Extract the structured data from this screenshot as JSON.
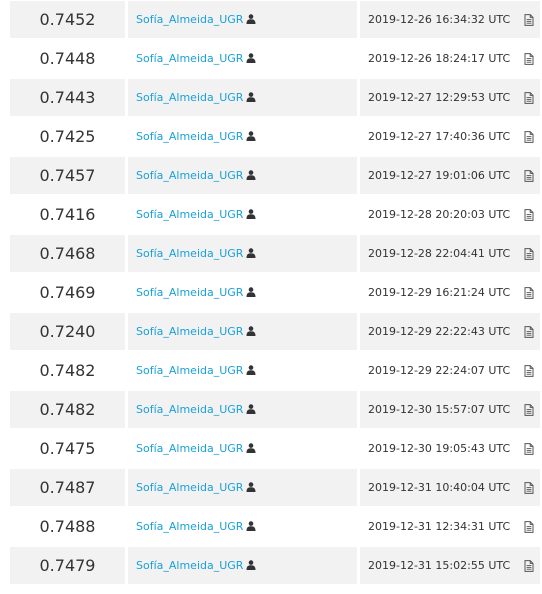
{
  "icons": {
    "user": "user-icon",
    "file": "file-icon"
  },
  "colors": {
    "link": "#1aa0d8",
    "stripe": "#f2f2f2",
    "text": "#333333"
  },
  "rows": [
    {
      "score": "0.7452",
      "user": "Sofía_Almeida_UGR",
      "date": "2019-12-26 16:34:32 UTC"
    },
    {
      "score": "0.7448",
      "user": "Sofía_Almeida_UGR",
      "date": "2019-12-26 18:24:17 UTC"
    },
    {
      "score": "0.7443",
      "user": "Sofía_Almeida_UGR",
      "date": "2019-12-27 12:29:53 UTC"
    },
    {
      "score": "0.7425",
      "user": "Sofía_Almeida_UGR",
      "date": "2019-12-27 17:40:36 UTC"
    },
    {
      "score": "0.7457",
      "user": "Sofía_Almeida_UGR",
      "date": "2019-12-27 19:01:06 UTC"
    },
    {
      "score": "0.7416",
      "user": "Sofía_Almeida_UGR",
      "date": "2019-12-28 20:20:03 UTC"
    },
    {
      "score": "0.7468",
      "user": "Sofía_Almeida_UGR",
      "date": "2019-12-28 22:04:41 UTC"
    },
    {
      "score": "0.7469",
      "user": "Sofía_Almeida_UGR",
      "date": "2019-12-29 16:21:24 UTC"
    },
    {
      "score": "0.7240",
      "user": "Sofía_Almeida_UGR",
      "date": "2019-12-29 22:22:43 UTC"
    },
    {
      "score": "0.7482",
      "user": "Sofía_Almeida_UGR",
      "date": "2019-12-29 22:24:07 UTC"
    },
    {
      "score": "0.7482",
      "user": "Sofía_Almeida_UGR",
      "date": "2019-12-30 15:57:07 UTC"
    },
    {
      "score": "0.7475",
      "user": "Sofía_Almeida_UGR",
      "date": "2019-12-30 19:05:43 UTC"
    },
    {
      "score": "0.7487",
      "user": "Sofía_Almeida_UGR",
      "date": "2019-12-31 10:40:04 UTC"
    },
    {
      "score": "0.7488",
      "user": "Sofía_Almeida_UGR",
      "date": "2019-12-31 12:34:31 UTC"
    },
    {
      "score": "0.7479",
      "user": "Sofía_Almeida_UGR",
      "date": "2019-12-31 15:02:55 UTC"
    }
  ]
}
